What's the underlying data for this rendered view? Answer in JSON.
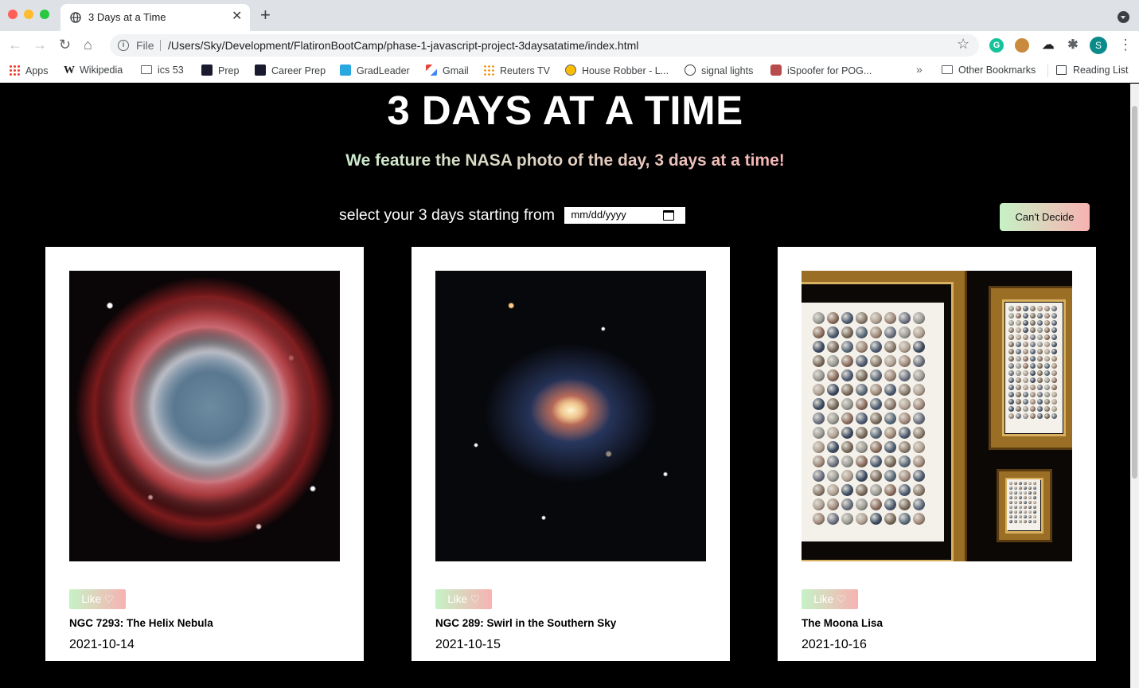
{
  "browser": {
    "tab_title": "3 Days at a Time",
    "tab_close": "✕",
    "new_tab": "+",
    "file_label": "File",
    "url": "/Users/Sky/Development/FlatironBootCamp/phase-1-javascript-project-3daysatatime/index.html",
    "avatar_letter": "S",
    "extensions": [
      "grammarly-icon",
      "cookie-icon",
      "cloud-icon",
      "puzzle-icon"
    ]
  },
  "bookmarks": {
    "items": [
      {
        "label": "Apps",
        "icon": "apps-grid-icon"
      },
      {
        "label": "Wikipedia",
        "icon": "wikipedia-icon"
      },
      {
        "label": "ics 53",
        "icon": "folder-icon"
      },
      {
        "label": "Prep",
        "icon": "slash-icon"
      },
      {
        "label": "Career Prep",
        "icon": "slash-icon"
      },
      {
        "label": "GradLeader",
        "icon": "slash-blue-icon"
      },
      {
        "label": "Gmail",
        "icon": "gmail-icon"
      },
      {
        "label": "Reuters TV",
        "icon": "reuters-icon"
      },
      {
        "label": "House Robber - L...",
        "icon": "leetcode-icon"
      },
      {
        "label": "signal lights",
        "icon": "globe-icon"
      },
      {
        "label": "iSpoofer for POG...",
        "icon": "ispoofer-icon"
      }
    ],
    "overflow": "»",
    "other_bookmarks": "Other Bookmarks",
    "reading_list": "Reading List"
  },
  "page": {
    "title": "3 DAYS AT A TIME",
    "tagline": "We feature the NASA photo of the day, 3 days at a time!",
    "date_label": "select your 3 days starting from",
    "date_placeholder": "mm/dd/yyyy",
    "cant_decide_label": "Can't Decide",
    "colors": {
      "background": "#000000",
      "gradient_green": "#c6f2c6",
      "gradient_pink": "#f7b2b2"
    }
  },
  "cards": [
    {
      "title": "NGC 7293: The Helix Nebula",
      "date": "2021-10-14",
      "like_label": "Like ♡",
      "image": "helix-nebula"
    },
    {
      "title": "NGC 289: Swirl in the Southern Sky",
      "date": "2021-10-15",
      "like_label": "Like ♡",
      "image": "spiral-galaxy"
    },
    {
      "title": "The Moona Lisa",
      "date": "2021-10-16",
      "like_label": "Like ♡",
      "image": "moona-lisa"
    }
  ]
}
